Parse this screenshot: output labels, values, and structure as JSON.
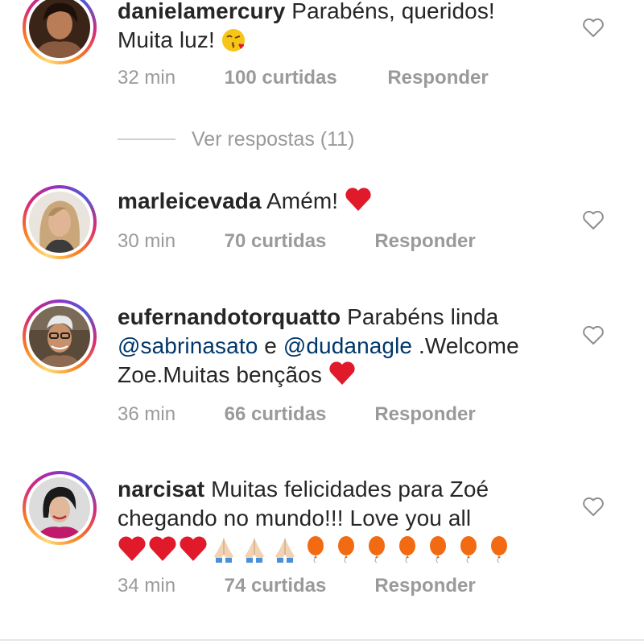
{
  "comments": [
    {
      "username": "danielamercury",
      "text_line1": "Parabéns, queridos!",
      "text_line2": "Muita luz!",
      "emoji": "😘",
      "time": "32 min",
      "likes": "100 curtidas",
      "reply": "Responder",
      "view_replies": "Ver respostas (11)"
    },
    {
      "username": "marleicevada",
      "text": "Amém!",
      "emoji": "❤️",
      "time": "30 min",
      "likes": "70 curtidas",
      "reply": "Responder"
    },
    {
      "username": "eufernandotorquatto",
      "text_line1": "Parabéns linda",
      "mention1": "@sabrinasato",
      "connector": "e",
      "mention2": "@dudanagle",
      "text_after": ".Welcome",
      "text_line3": "Zoe.Muitas bençãos",
      "emoji": "❤️",
      "time": "36 min",
      "likes": "66 curtidas",
      "reply": "Responder"
    },
    {
      "username": "narcisat",
      "text_line1": "Muitas felicidades para Zoé",
      "text_line2": "chegando no mundo!!! Love you all",
      "emojis": "❤️❤️❤️🙏🏻🙏🏻🙏🏻🎈🎈🎈🎈🎈🎈🎈",
      "time": "34 min",
      "likes": "74 curtidas",
      "reply": "Responder"
    }
  ],
  "icons": {
    "like": "heart-outline-icon",
    "emoji_heart": "red-heart-emoji",
    "emoji_pray": "folded-hands-emoji",
    "emoji_balloon": "balloon-emoji",
    "emoji_kiss": "face-blowing-kiss-emoji"
  },
  "colors": {
    "text": "#262626",
    "meta": "#9a9a9a",
    "mention": "#00376b",
    "heart": "#e0192b",
    "balloon": "#f26a11"
  }
}
